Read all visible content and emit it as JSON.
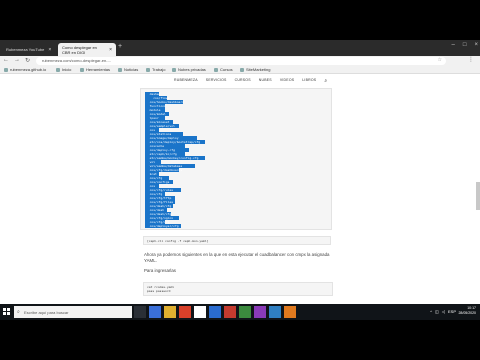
{
  "browser": {
    "tabs": [
      {
        "label": "Rubenmeza YouTube",
        "active": false
      },
      {
        "label": "Como desplegar en CBR en DIGI",
        "active": true
      }
    ],
    "url": "rubenmeza.com/como-desplegar-en-...",
    "bookmarks": [
      "rubenmeza.github.io",
      "Inicio",
      "Herramientas",
      "Noticias",
      "Trabajo",
      "Nubes privadas",
      "Cursos",
      "SiteMarketing"
    ]
  },
  "site": {
    "nav": [
      "RUBENMEZA",
      "SERVICIOS",
      "CURSOS",
      "NUBES",
      "VIDEOS",
      "LIBROS"
    ]
  },
  "code_block_1": {
    "lines": [
      "  dashed",
      "    cos/flows",
      "  cos/hooks/dashboard",
      "  functions",
      "  module",
      "  cos/model",
      "  lpeor",
      "  cos/mineset",
      "  cos/sample/vol",
      "  cos",
      "  cos/stations",
      "  cos/image/deploy",
      "  etc/cos/deploy/bootstrap/cfg",
      "  coscache",
      "  cos/deploy-cfg",
      "  etc/ceph/kc/cfg",
      "  etc/samba/monkey/config-cfg",
      "  vol",
      "  vol/samba/database",
      "  cos/cfg/dashboards",
      "  kcat",
      "  cos/cfg",
      "  cos/configs",
      "  cos",
      "  cos/cfg/rules",
      "  cos/cfg",
      "  cos/cfg/tftp",
      "  cos/cfg/files",
      "  cos/dash/cfg",
      "  cos/dash",
      "  cos/dash/cfg/",
      "  cos/cfg/nginx",
      "  cos/cfg/cfg",
      "  cos/deployer/cfg"
    ]
  },
  "code_block_2": "[ceph-cli config -f ceph-mon.yaml]",
  "paragraph": "Ahora ya podemos siguientes en la que en esta ejecutar el cuadbalancer con cmpx la asignada YAML.",
  "subheading": "Para ingresarlas",
  "code_block_3": [
    "cat rcodes.yaml",
    "pass password"
  ],
  "taskbar": {
    "search_placeholder": "Escribe aquí para buscar",
    "time": "10:17",
    "date": "28/05/2020",
    "lang": "ESP"
  }
}
